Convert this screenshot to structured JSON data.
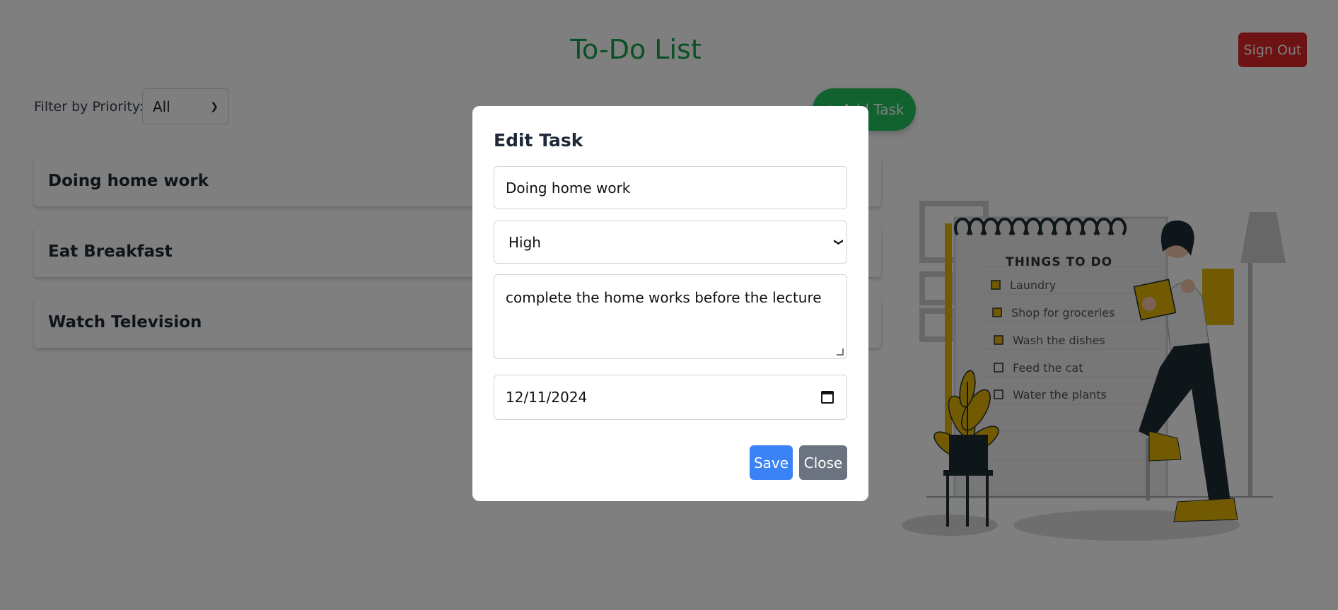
{
  "header": {
    "title": "To-Do List",
    "signout_label": "Sign Out"
  },
  "filter": {
    "label": "Filter by Priority:",
    "selected": "All"
  },
  "add_task": {
    "icon": "+",
    "label": "Add Task"
  },
  "tasks": [
    {
      "title": "Doing home work"
    },
    {
      "title": "Eat Breakfast"
    },
    {
      "title": "Watch Television"
    }
  ],
  "illustration": {
    "heading": "THINGS TO DO",
    "items": [
      {
        "text": "Laundry",
        "checked": true
      },
      {
        "text": "Shop for groceries",
        "checked": true
      },
      {
        "text": "Wash the dishes",
        "checked": true
      },
      {
        "text": "Feed the cat",
        "checked": false
      },
      {
        "text": "Water the plants",
        "checked": false
      }
    ]
  },
  "modal": {
    "title": "Edit Task",
    "name_value": "Doing home work",
    "priority_value": "High",
    "description_value": "complete the home works before the lecture",
    "date_value": "12/11/2024",
    "save_label": "Save",
    "close_label": "Close"
  },
  "colors": {
    "title_green": "#16a34a",
    "signout_red": "#dc2626",
    "add_green": "#22c55e",
    "save_blue": "#3b82f6",
    "close_gray": "#6b7280",
    "illustration_yellow": "#e3b505",
    "illustration_dark": "#1f2d33"
  }
}
